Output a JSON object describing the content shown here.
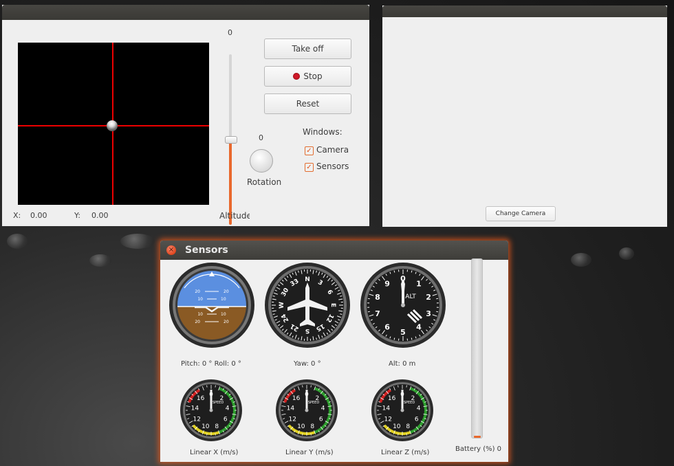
{
  "control_window": {
    "take_off_label": "Take off",
    "stop_label": "Stop",
    "reset_label": "Reset",
    "altitude": {
      "value": "0",
      "label": "Altitude"
    },
    "rotation": {
      "value": "0",
      "label": "Rotation"
    },
    "windows_label": "Windows:",
    "checkboxes": [
      {
        "label": "Camera",
        "checked": true
      },
      {
        "label": "Sensors",
        "checked": true
      }
    ],
    "x_label": "X:",
    "x_value": "0.00",
    "y_label": "Y:",
    "y_value": "0.00"
  },
  "camera_window": {
    "change_camera_label": "Change Camera"
  },
  "sensors_window": {
    "title": "Sensors",
    "attitude_caption": "Pitch:  0  °  Roll:  0  °",
    "yaw_caption": "Yaw:  0  °",
    "alt_caption": "Alt:  0  m",
    "linear_x_caption": "Linear X (m/s)",
    "linear_y_caption": "Linear Y (m/s)",
    "linear_z_caption": "Linear Z (m/s)",
    "battery_caption": "Battery (%)  0",
    "battery_percent": 0,
    "compass_labels": [
      "N",
      "3",
      "6",
      "E",
      "12",
      "15",
      "S",
      "21",
      "24",
      "W",
      "30",
      "33"
    ],
    "altimeter_labels": [
      "0",
      "1",
      "2",
      "3",
      "4",
      "5",
      "6",
      "7",
      "8",
      "9"
    ],
    "altimeter_center": "ALT",
    "speed_labels": [
      "0",
      "2",
      "4",
      "6",
      "8",
      "10",
      "12",
      "14",
      "16"
    ],
    "speed_center": "SPEED",
    "attitude_marks": [
      "20",
      "10",
      "10",
      "20"
    ]
  },
  "colors": {
    "accent": "#e9682c",
    "sky": "#5b8fe0",
    "ground": "#8a5a24",
    "crosshair": "#ee0000"
  }
}
